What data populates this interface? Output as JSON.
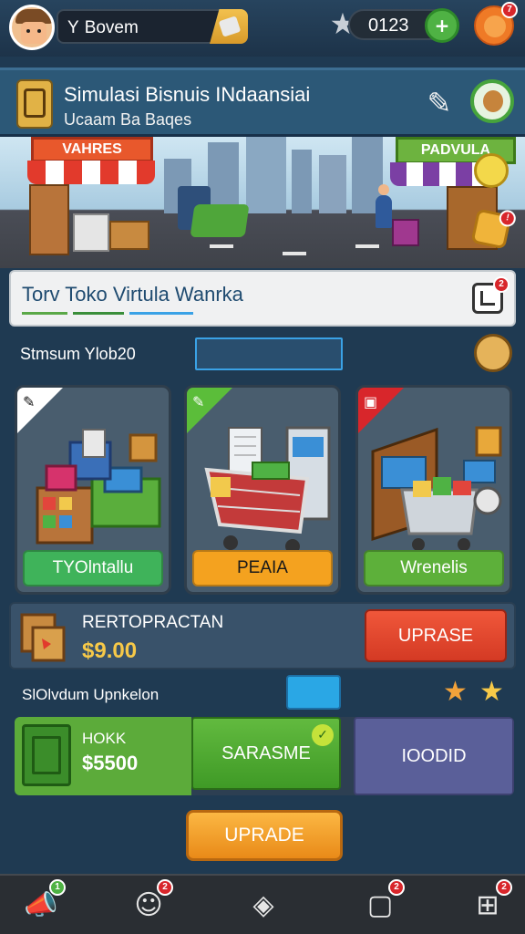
{
  "topbar": {
    "player_lead": "Y",
    "player_name": "Bovem",
    "coins": "0123",
    "notif_badge": "7"
  },
  "header": {
    "title": "Simulasi Bisnuis INdaansiai",
    "subtitle": "Ucaam Ba Baqes"
  },
  "scene": {
    "left_sign": "VAHRES",
    "right_sign": "PADVULA"
  },
  "store": {
    "title": "Torv Toko Virtula Wanrka",
    "edit_badge": "2"
  },
  "section1": {
    "label": "Stmsum Ylob20"
  },
  "cards": [
    {
      "button": "TYOlntallu",
      "button_color": "#3fb35a",
      "ribbon_color": "#ffffff"
    },
    {
      "button": "PEAIA",
      "button_color": "#f4a21f",
      "ribbon_color": "#5bbd3a"
    },
    {
      "button": "Wrenelis",
      "button_color": "#5db03a",
      "ribbon_color": "#d8262b"
    }
  ],
  "upgrade1": {
    "title": "RERTOPRACTAN",
    "price": "$9.00",
    "button": "UPRASE"
  },
  "section2": {
    "label": "SlOlvdum Upnkelon"
  },
  "upgrade2": {
    "item_name": "HOKK",
    "item_price": "$5500",
    "buy_green": "SARASME",
    "buy_purple": "IOODID"
  },
  "main_button": "UPRADE",
  "nav": {
    "badge1": "1",
    "badge2": "2",
    "badge4": "2",
    "badge5": "2"
  },
  "colors": {
    "accent_gold": "#f7c948",
    "accent_red": "#d43a24",
    "accent_green": "#4fb244",
    "panel_blue": "#2c5877"
  }
}
